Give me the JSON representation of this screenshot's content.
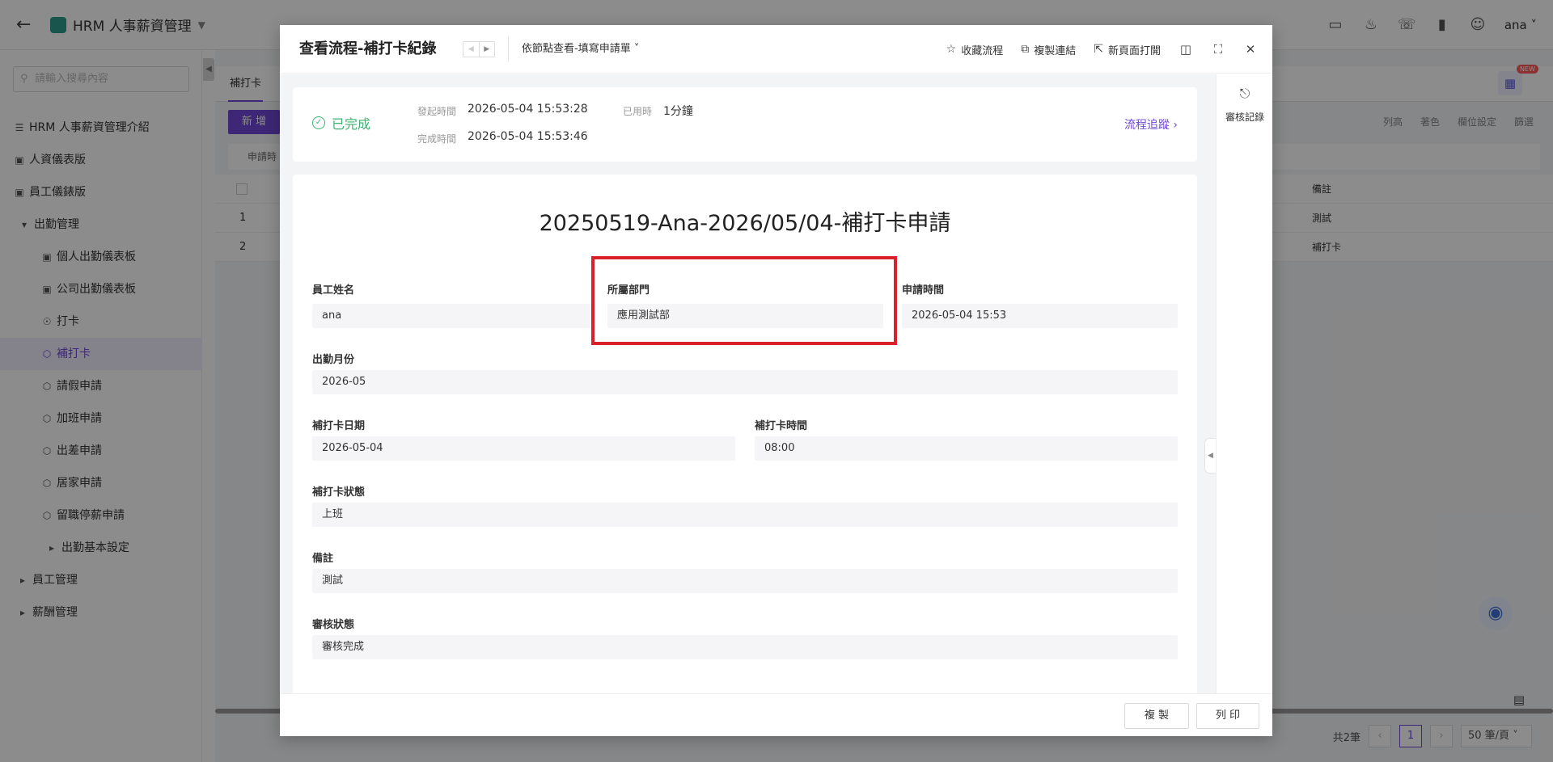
{
  "app": {
    "title": "HRM 人事薪資管理",
    "user": "ana"
  },
  "sidebar": {
    "search_placeholder": "請輸入搜尋內容",
    "items": [
      {
        "label": "HRM 人事薪資管理介紹",
        "icon": "list-icon"
      },
      {
        "label": "人資儀表版",
        "icon": "dashboard-icon"
      },
      {
        "label": "員工儀錶版",
        "icon": "dashboard-icon"
      },
      {
        "label": "出勤管理",
        "icon": "caret-down-icon"
      },
      {
        "label": "個人出勤儀表板",
        "icon": "dashboard-icon"
      },
      {
        "label": "公司出勤儀表板",
        "icon": "dashboard-icon"
      },
      {
        "label": "打卡",
        "icon": "user-icon"
      },
      {
        "label": "補打卡",
        "icon": "cube-icon"
      },
      {
        "label": "請假申請",
        "icon": "cube-icon"
      },
      {
        "label": "加班申請",
        "icon": "cube-icon"
      },
      {
        "label": "出差申請",
        "icon": "cube-icon"
      },
      {
        "label": "居家申請",
        "icon": "cube-icon"
      },
      {
        "label": "留職停薪申請",
        "icon": "cube-icon"
      },
      {
        "label": "出勤基本設定",
        "icon": "caret-right-icon"
      },
      {
        "label": "員工管理",
        "icon": "caret-right-icon"
      },
      {
        "label": "薪酬管理",
        "icon": "caret-right-icon"
      }
    ],
    "active_index": 7
  },
  "main": {
    "tab": "補打卡",
    "add_label": "新 增",
    "filter_label": "申請時",
    "toolbar": [
      "列高",
      "著色",
      "欄位設定",
      "篩選"
    ],
    "new_badge": "NEW",
    "column_note": "備註",
    "rows": [
      {
        "index": "1",
        "note": "測試"
      },
      {
        "index": "2",
        "note": "補打卡"
      }
    ],
    "pager": {
      "total": "共2筆",
      "page": "1",
      "size": "50 筆/頁"
    }
  },
  "modal": {
    "title": "查看流程-補打卡紀錄",
    "view_select": "依節點查看-填寫申請單",
    "actions": {
      "favorite": "收藏流程",
      "copy_link": "複製連結",
      "open_new": "新頁面打開"
    },
    "status": {
      "label": "已完成",
      "start_label": "發起時間",
      "start_value": "2026-05-04 15:53:28",
      "used_label": "已用時",
      "used_value": "1分鐘",
      "end_label": "完成時間",
      "end_value": "2026-05-04 15:53:46",
      "trace_link": "流程追蹤"
    },
    "form": {
      "title": "20250519-Ana-2026/05/04-補打卡申請",
      "employee_name": {
        "label": "員工姓名",
        "value": "ana"
      },
      "department": {
        "label": "所屬部門",
        "value": "應用測試部"
      },
      "apply_time": {
        "label": "申請時間",
        "value": "2026-05-04 15:53"
      },
      "attendance_month": {
        "label": "出勤月份",
        "value": "2026-05"
      },
      "punch_date": {
        "label": "補打卡日期",
        "value": "2026-05-04"
      },
      "punch_time": {
        "label": "補打卡時間",
        "value": "08:00"
      },
      "punch_status": {
        "label": "補打卡狀態",
        "value": "上班"
      },
      "remark": {
        "label": "備註",
        "value": "測試"
      },
      "review_status": {
        "label": "審核狀態",
        "value": "審核完成"
      }
    },
    "side_panel": {
      "label": "審核記錄"
    },
    "footer": {
      "copy": "複 製",
      "print": "列 印"
    }
  }
}
